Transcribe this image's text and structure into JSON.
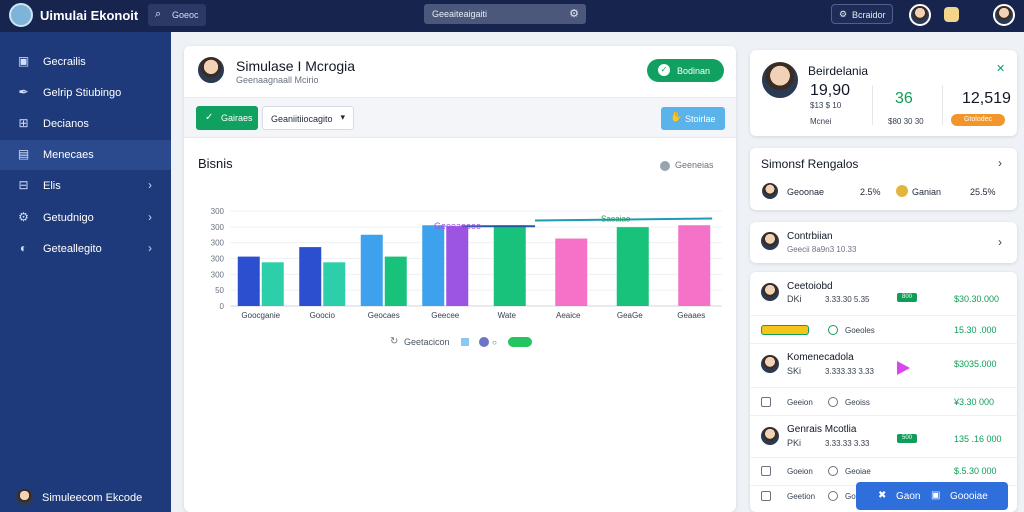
{
  "app": {
    "title": "Uimulai Ekonoit"
  },
  "topbar": {
    "search_button_label": "Goeoc",
    "center_search_value": "Geeaiteaigaiti",
    "pill_label": "Bcraidor"
  },
  "sidebar": {
    "items": [
      {
        "label": "Gecrailis",
        "icon": "square-icon",
        "has_chevron": false
      },
      {
        "label": "Gelrip Stiubingo",
        "icon": "tag-icon",
        "has_chevron": false
      },
      {
        "label": "Decianos",
        "icon": "grid-icon",
        "has_chevron": false
      },
      {
        "label": "Menecaes",
        "icon": "calendar-icon",
        "has_chevron": false
      },
      {
        "label": "Elis",
        "icon": "grid-icon",
        "has_chevron": true
      },
      {
        "label": "Getudnigo",
        "icon": "settings-icon",
        "has_chevron": true
      },
      {
        "label": "Geteallegito",
        "icon": "globe-icon",
        "has_chevron": true
      }
    ],
    "footer_user": "Simuleecom Ekcode"
  },
  "main": {
    "title": "Simulase I Mcrogia",
    "subtitle": "Geenaagnaall Mcirio",
    "header_button_label": "Bodinan",
    "toolbar": {
      "green_button_label": "Gairaes",
      "dropdown_value": "Geaniitiiocagito",
      "blue_button_label": "Stoirlae"
    },
    "chart_title": "Bisnis",
    "chart_legend_label": "Geeneias",
    "chart_footer_label": "Geetacicon"
  },
  "chart_data": {
    "type": "bar",
    "title": "Bisnis",
    "y_ticks": [
      "300",
      "300",
      "300",
      "300",
      "300",
      "50",
      "0"
    ],
    "categories": [
      "Goocganie",
      "Goocio",
      "Geocaes",
      "Geecee",
      "Wate",
      "Aeaice",
      "GeaGe",
      "Geaaes"
    ],
    "series": [
      {
        "values": [
          52,
          62,
          75,
          85,
          85,
          71,
          83,
          85
        ]
      },
      {
        "values": [
          46,
          46,
          52,
          84,
          null,
          null,
          null,
          null
        ]
      }
    ],
    "bar_colors": [
      "#2c4fd0",
      "#2c4fd0",
      "#3ea1ee",
      "#3ea1ee",
      "#18c27a",
      "#f472c8",
      "#18c27a",
      "#f472c8"
    ],
    "second_colors": [
      "#2ccfa9",
      "#2ccfa9",
      "#18c27a",
      "#9b55e0"
    ],
    "ylim": [
      0,
      100
    ],
    "annotations": [
      {
        "text": "Geeeaeooo",
        "color": "#9b55e0"
      },
      {
        "text": "Saeaiae",
        "color": "#0f9d58"
      }
    ],
    "trend_lines": [
      {
        "from": 0.47,
        "to": 0.62,
        "level": 84,
        "color": "#1f5aa8"
      },
      {
        "from": 0.62,
        "to": 0.98,
        "level": 90,
        "color": "#1f9bb0"
      }
    ]
  },
  "right": {
    "profile_card": {
      "name": "Beirdelania",
      "stats": [
        {
          "value": "19,90",
          "sub": "$13 $ 10",
          "color": "#111827"
        },
        {
          "value": "36",
          "sub": "$80 30 30",
          "color": "#0f9d58"
        },
        {
          "value": "12,519",
          "sub": "",
          "color": "#111827"
        }
      ],
      "mid_label": "Mcnei",
      "badge": "Gtolodec",
      "close_icon": "close-icon"
    },
    "list_card": {
      "title": "Simonsf Rengalos",
      "item": {
        "name": "Geoonae",
        "pct1": "2.5%",
        "coin_label": "Ganian",
        "pct2": "25.5%"
      }
    },
    "contact_card": {
      "title": "Contrbiian",
      "sub": "Geecii 8a9n3 10.33"
    },
    "transactions": [
      {
        "type": "person",
        "name": "Ceetoiobd",
        "code": "DKi",
        "nums": "3.33.30 5.35",
        "badge": "800",
        "amount": "$30.30.000"
      },
      {
        "type": "chip",
        "label2": "Goeoles",
        "amount": "15.30 .000"
      },
      {
        "type": "person",
        "name": "Komenecadola",
        "code": "SKi",
        "nums": "3.333.33 3.33",
        "badge": "",
        "amount": "$3035.000"
      },
      {
        "type": "icon",
        "label1": "Geeion",
        "label2": "Geoiss",
        "amount": "¥3.30 000"
      },
      {
        "type": "person",
        "name": "Genrais Mcotlia",
        "code": "PKi",
        "nums": "3.33.33 3.33",
        "badge": "500",
        "amount": "135 .16 000"
      },
      {
        "type": "icon",
        "label1": "Goeion",
        "label2": "Geoiae",
        "amount": "$.5.30 000"
      },
      {
        "type": "icon",
        "label1": "Geetion",
        "label2": "Goeiocn",
        "amount": ""
      }
    ],
    "bottom_button": {
      "label1": "Gaon",
      "label2": "Goooiae"
    }
  }
}
